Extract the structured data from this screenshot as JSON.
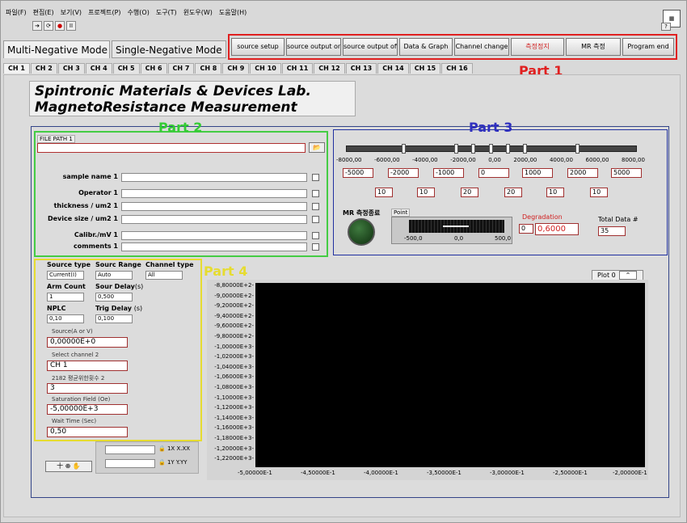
{
  "menu": [
    "파일(F)",
    "편집(E)",
    "보기(V)",
    "프로젝트(P)",
    "수행(O)",
    "도구(T)",
    "윈도우(W)",
    "도움말(H)"
  ],
  "toolbar": {
    "run": "➔",
    "cont": "⟳",
    "stop": "●",
    "pause": "II"
  },
  "help_button": "?",
  "modes": {
    "multi": "Multi-Negative Mode",
    "single": "Single-Negative Mode"
  },
  "part1": {
    "label": "Part 1",
    "buttons": [
      "source setup",
      "source output on",
      "source output off",
      "Data & Graph",
      "Channel change",
      "측정정지",
      "MR 측정",
      "Program end"
    ]
  },
  "channels": [
    "CH 1",
    "CH 2",
    "CH 3",
    "CH 4",
    "CH 5",
    "CH 6",
    "CH 7",
    "CH 8",
    "CH 9",
    "CH 10",
    "CH 11",
    "CH 12",
    "CH 13",
    "CH 14",
    "CH 15",
    "CH 16"
  ],
  "lab_title": [
    "Spintronic Materials & Devices Lab.",
    "MagnetoResistance Measurement"
  ],
  "part2": {
    "label": "Part 2",
    "file_path_label": "FILE PATH 1",
    "file_path_value": "",
    "fields": [
      {
        "label": "sample name 1",
        "value": ""
      },
      {
        "label": "Operator 1",
        "value": ""
      },
      {
        "label": "thickness / um2 1",
        "value": ""
      },
      {
        "label": "Device size / um2 1",
        "value": ""
      },
      {
        "label": "Calibr./mV 1",
        "value": ""
      },
      {
        "label": "comments 1",
        "value": ""
      }
    ]
  },
  "part3": {
    "label": "Part 3",
    "slider_ticks": [
      "-8000,00",
      "-6000,00",
      "-4000,00",
      "-2000,00",
      "0,00",
      "2000,00",
      "4000,00",
      "6000,00",
      "8000,00"
    ],
    "fields": [
      "-5000",
      "-2000",
      "-1000",
      "0",
      "1000",
      "2000",
      "5000"
    ],
    "steps": [
      "10",
      "10",
      "20",
      "20",
      "10",
      "10"
    ],
    "mr_done_label": "MR 측정종료",
    "point_label": "Point",
    "point_ticks": [
      "-500,0",
      "0,0",
      "500,0"
    ],
    "degradation_label": "Degradation",
    "degradation_spin": "0",
    "degradation_value": "0,6000",
    "total_label": "Total Data #",
    "total_value": "35"
  },
  "part4": {
    "label": "Part 4",
    "source_type_label": "Source type",
    "source_type": "Current(I)",
    "sourc_range_label": "Sourc Range",
    "sourc_range": "Auto",
    "channel_type_label": "Channel type",
    "channel_type": "All",
    "arm_count_label": "Arm Count",
    "arm_count": "1",
    "sour_delay_label": "Sour Delay",
    "sour_delay_unit": "(s)",
    "sour_delay": "0,500",
    "nplc_label": "NPLC",
    "nplc": "0,10",
    "trig_delay_label": "Trig Delay",
    "trig_delay_unit": "(s)",
    "trig_delay": "0,100",
    "source_label": "Source(A or V)",
    "source_value": "0,00000E+0",
    "select_channel_label": "Select channel 2",
    "select_channel_value": "CH 1",
    "avg_label": "2182 평균위한횟수 2",
    "avg_value": "3",
    "saturation_label": "Saturation Field (Oe)",
    "saturation_value": "-5,00000E+3",
    "wait_label": "Wait Time (Sec)",
    "wait_value": "0,50"
  },
  "graph": {
    "plot_legend": "Plot 0",
    "yticks": [
      "-8,80000E+2-",
      "-9,00000E+2-",
      "-9,20000E+2-",
      "-9,40000E+2-",
      "-9,60000E+2-",
      "-9,80000E+2-",
      "-1,00000E+3-",
      "-1,02000E+3-",
      "-1,04000E+3-",
      "-1,06000E+3-",
      "-1,08000E+3-",
      "-1,10000E+3-",
      "-1,12000E+3-",
      "-1,14000E+3-",
      "-1,16000E+3-",
      "-1,18000E+3-",
      "-1,20000E+3-",
      "-1,22000E+3-"
    ],
    "xticks": [
      "-5,00000E-1",
      "-4,50000E-1",
      "-4,00000E-1",
      "-3,50000E-1",
      "-3,00000E-1",
      "-2,50000E-1",
      "-2,00000E-1"
    ]
  },
  "bottom_palette": "十 ⊕ ✋",
  "readouts": [
    {
      "value": "",
      "a": "1X",
      "b": "X.XX"
    },
    {
      "value": "",
      "a": "1Y",
      "b": "Y.YY"
    }
  ]
}
